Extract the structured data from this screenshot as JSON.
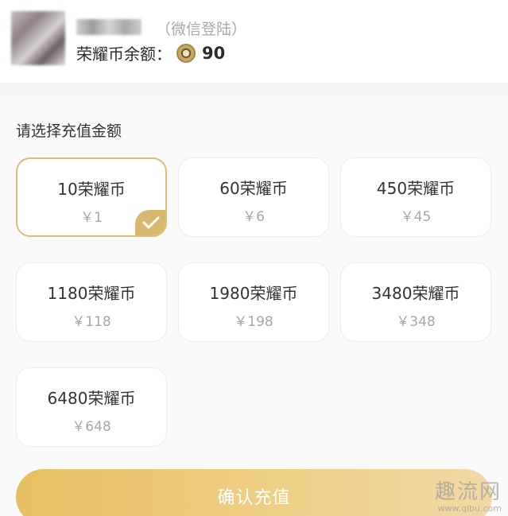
{
  "header": {
    "login_type": "（微信登陆）",
    "balance_label": "荣耀币余额：",
    "balance_value": "90"
  },
  "section_title": "请选择充值金额",
  "options": [
    {
      "coins": "10荣耀币",
      "price": "￥1",
      "selected": true
    },
    {
      "coins": "60荣耀币",
      "price": "￥6",
      "selected": false
    },
    {
      "coins": "450荣耀币",
      "price": "￥45",
      "selected": false
    },
    {
      "coins": "1180荣耀币",
      "price": "￥118",
      "selected": false
    },
    {
      "coins": "1980荣耀币",
      "price": "￥198",
      "selected": false
    },
    {
      "coins": "3480荣耀币",
      "price": "￥348",
      "selected": false
    },
    {
      "coins": "6480荣耀币",
      "price": "￥648",
      "selected": false
    }
  ],
  "confirm_label": "确认充值",
  "watermark": {
    "text": "趣流网",
    "url": "www.qlbu.com"
  },
  "colors": {
    "accent": "#dcbc73",
    "button_start": "#e7bf62",
    "button_end": "#f2d9a6"
  }
}
